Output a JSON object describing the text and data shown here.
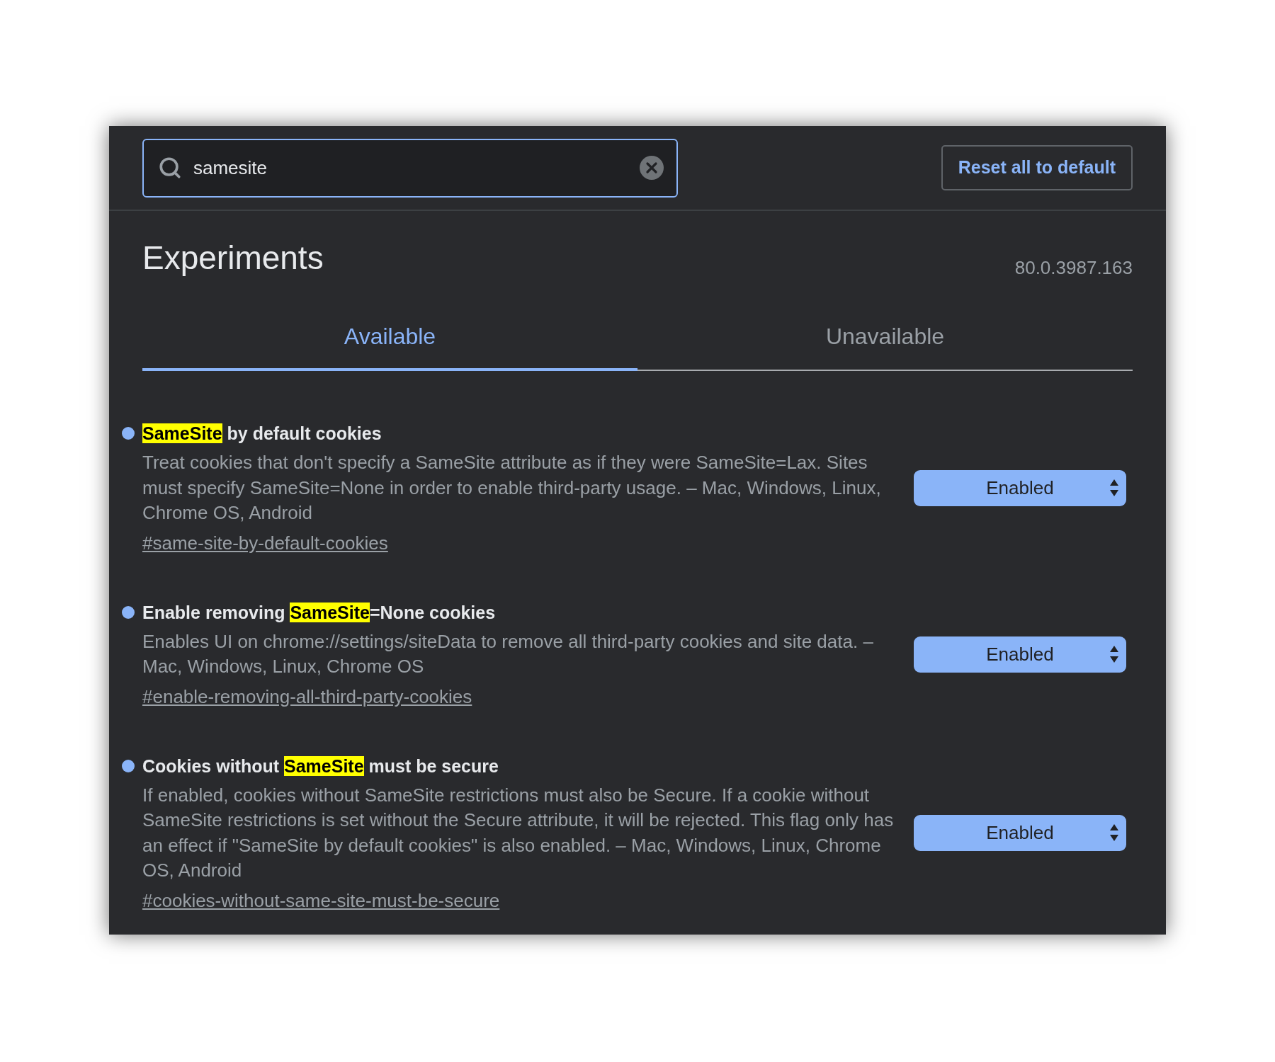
{
  "search": {
    "value": "samesite"
  },
  "reset_button": {
    "label": "Reset all to default"
  },
  "page": {
    "title": "Experiments",
    "version": "80.0.3987.163"
  },
  "tabs": [
    {
      "label": "Available",
      "selected": true
    },
    {
      "label": "Unavailable",
      "selected": false
    }
  ],
  "experiments": [
    {
      "modified": true,
      "title": [
        {
          "text": "SameSite",
          "highlight": true
        },
        {
          "text": " by default cookies",
          "highlight": false
        }
      ],
      "description": "Treat cookies that don't specify a SameSite attribute as if they were SameSite=Lax. Sites must specify SameSite=None in order to enable third-party usage. – Mac, Windows, Linux, Chrome OS, Android",
      "link": "#same-site-by-default-cookies",
      "value": "Enabled"
    },
    {
      "modified": true,
      "title": [
        {
          "text": "Enable removing ",
          "highlight": false
        },
        {
          "text": "SameSite",
          "highlight": true
        },
        {
          "text": "=None cookies",
          "highlight": false
        }
      ],
      "description": "Enables UI on chrome://settings/siteData to remove all third-party cookies and site data. – Mac, Windows, Linux, Chrome OS",
      "link": "#enable-removing-all-third-party-cookies",
      "value": "Enabled"
    },
    {
      "modified": true,
      "title": [
        {
          "text": "Cookies without ",
          "highlight": false
        },
        {
          "text": "SameSite",
          "highlight": true
        },
        {
          "text": " must be secure",
          "highlight": false
        }
      ],
      "description": "If enabled, cookies without SameSite restrictions must also be Secure. If a cookie without SameSite restrictions is set without the Secure attribute, it will be rejected. This flag only has an effect if \"SameSite by default cookies\" is also enabled. – Mac, Windows, Linux, Chrome OS, Android",
      "link": "#cookies-without-same-site-must-be-secure",
      "value": "Enabled"
    }
  ]
}
